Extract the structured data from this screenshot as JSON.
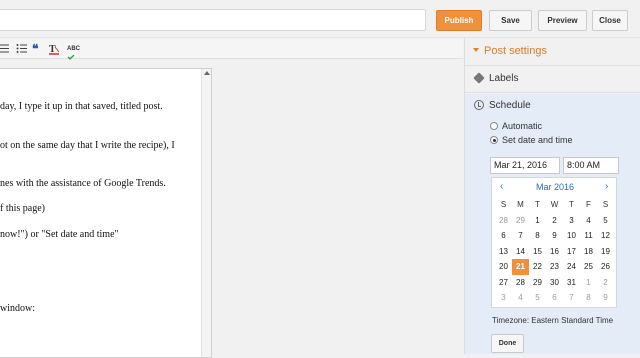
{
  "topbar": {
    "title_value": "",
    "publish_label": "Publish",
    "save_label": "Save",
    "preview_label": "Preview",
    "close_label": "Close"
  },
  "toolbar": {
    "icons": [
      "numbered-list-icon",
      "bullet-list-icon",
      "quote-icon",
      "remove-formatting-icon",
      "spellcheck-icon"
    ],
    "spellcheck_label": "ABC"
  },
  "editor": {
    "lines": [
      "day, I type it up in that saved, titled post.",
      "ot on the same day that I write the recipe), I",
      "nes with the assistance of Google Trends.",
      "f this page)",
      "now!\")  or \"Set date and time\"",
      "window:"
    ]
  },
  "sidebar": {
    "post_settings_label": "Post settings",
    "labels_label": "Labels",
    "schedule_label": "Schedule",
    "automatic_label": "Automatic",
    "set_date_label": "Set date and time",
    "date_value": "Mar 21, 2016",
    "time_value": "8:00 AM",
    "calendar": {
      "prev": "‹",
      "next": "›",
      "month": "Mar 2016",
      "weekdays": [
        "S",
        "M",
        "T",
        "W",
        "T",
        "F",
        "S"
      ],
      "weeks": [
        [
          "28",
          "29",
          "1",
          "2",
          "3",
          "4",
          "5"
        ],
        [
          "6",
          "7",
          "8",
          "9",
          "10",
          "11",
          "12"
        ],
        [
          "13",
          "14",
          "15",
          "16",
          "17",
          "18",
          "19"
        ],
        [
          "20",
          "21",
          "22",
          "23",
          "24",
          "25",
          "26"
        ],
        [
          "27",
          "28",
          "29",
          "30",
          "31",
          "1",
          "2"
        ],
        [
          "3",
          "4",
          "5",
          "6",
          "7",
          "8",
          "9"
        ]
      ],
      "selected_day": "21"
    },
    "timezone_label": "Timezone: Eastern Standard Time",
    "done_label": "Done"
  },
  "colors": {
    "accent": "#f0903b",
    "link_blue": "#2a6db5",
    "schedule_bg": "#e4ecf7"
  }
}
